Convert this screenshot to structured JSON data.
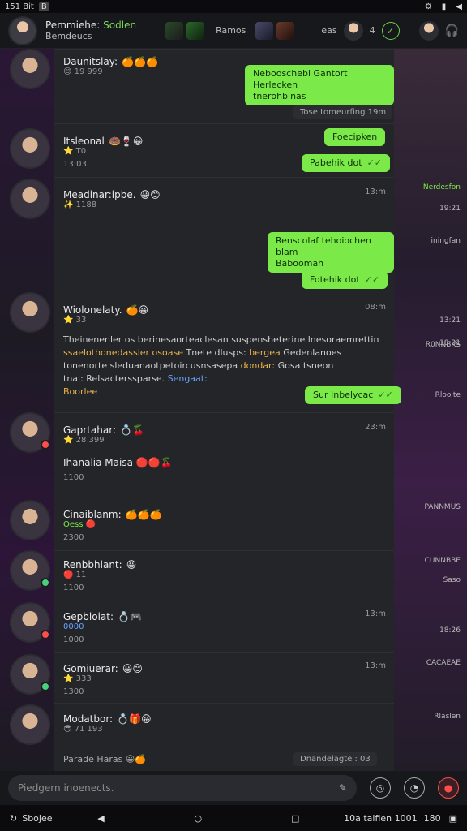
{
  "status_bar": {
    "time": "151 Bit",
    "badge": "B"
  },
  "header": {
    "title": "Pemmiehe:",
    "status": "Sodlen",
    "subtitle": "Bemdeucs",
    "tab_text": "Ramos",
    "tab_text2": "eas",
    "count": "4"
  },
  "threads": [
    {
      "name": "Daunitslay:",
      "emojis": "🍊🍊🍊",
      "meta": "19 999",
      "meta_icon": "😊"
    },
    {
      "name": "Itsleonal",
      "emojis": "🍩🍷😀",
      "meta": "T0",
      "sub": "13:03",
      "meta_icon": "⭐"
    },
    {
      "name": "Meadinar:ipbe.",
      "emojis": "😀😊",
      "meta": "1188",
      "time": "13:m",
      "meta_icon": "✨"
    },
    {
      "name": "Wiolonelaty.",
      "emojis": "🍊😀",
      "meta": "33",
      "time": "08:m",
      "long1": "Theinenenler os berinesaorteaclesan suspensheterine lnesoraemrettin",
      "long2a": "ssaelothonedassier osoase",
      "long2b": "Tnete dlusps:",
      "long2c": "bergea",
      "long2d": "Gedenlanoes",
      "long3a": "tonenorte sleduanaotpetoircusnsasepa",
      "long3b": "dondar:",
      "long3c": "Gosa tsneon",
      "long4a": "tnal: Relsacterssparse.",
      "long4b": "Sengaat:",
      "foot": "Boorlee"
    },
    {
      "name": "Gaprtahar:",
      "emojis": "💍🍒",
      "meta": "28 399",
      "time": "23:m",
      "sub2": "Ihanalia Maisa",
      "sub_meta": "1100",
      "meta_icon": "⭐"
    },
    {
      "name": "Cinaiblanm:",
      "emojis": "🍊🍊🍊",
      "meta": "Oess",
      "sub": "2300",
      "meta_icon": "🔴"
    },
    {
      "name": "Renbbhiant:",
      "emojis": "😀",
      "meta": "11",
      "sub": "1100",
      "meta_icon": "🔴"
    },
    {
      "name": "Gepbloiat:",
      "emojis": "💍🎮",
      "meta": "0000",
      "sub": "1000",
      "time": "13:m"
    },
    {
      "name": "Gomiuerar:",
      "emojis": "😀😊",
      "meta": "333",
      "sub": "1300",
      "time": "13:m"
    },
    {
      "name": "Modatbor:",
      "emojis": "💍🎁😀",
      "meta": "71 193",
      "sub2": "Parade Haras",
      "pill": "Dnandelagte : 03"
    }
  ],
  "out_messages": [
    {
      "text": "Nebooschebl Gantort Herlecken",
      "text2": "tnerohbinas"
    },
    {
      "text": "Foecipken"
    },
    {
      "text": "Pabehik dot"
    },
    {
      "text": "Renscolaf tehoiochen blam",
      "text2": "Baboomah"
    },
    {
      "text": "Fotehik dot"
    },
    {
      "text": "Sur Inbelycac"
    }
  ],
  "pills": {
    "p1": "Tose tomeurfing 19m"
  },
  "right_strip": [
    "Nerdesfon",
    "19:21",
    "iningfan",
    "13:21",
    "18:31",
    "R0NNBKS",
    "Rlooite",
    "PANNMUS",
    "CUNNBBE",
    "Saso",
    "18:26",
    "CACAEAE",
    "Rlaslen"
  ],
  "composer": {
    "placeholder": "Piedgern inoenects."
  },
  "navbar": {
    "left": "Sbojee",
    "right": "10a talfien 1001",
    "right2": "180"
  }
}
